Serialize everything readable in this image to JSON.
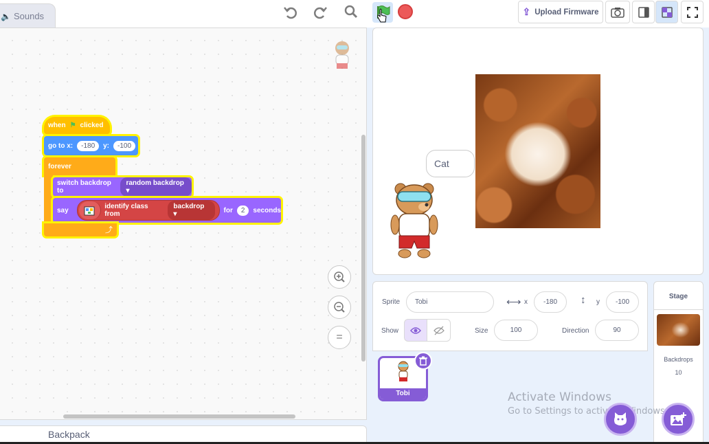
{
  "tabs": {
    "sounds": "Sounds"
  },
  "toolbar": {
    "upload_firmware": "Upload Firmware"
  },
  "script": {
    "hat": {
      "text": "when",
      "text2": "clicked"
    },
    "goto": {
      "label": "go to x:",
      "x": "-180",
      "ylabel": "y:",
      "y": "-100"
    },
    "forever": {
      "label": "forever"
    },
    "switch_backdrop": {
      "label": "switch backdrop to",
      "value": "random backdrop"
    },
    "say": {
      "label": "say",
      "classify": "identify class from",
      "classify_value": "backdrop",
      "for": "for",
      "seconds_value": "2",
      "seconds": "seconds"
    }
  },
  "zoom": {
    "reset": "="
  },
  "backpack": {
    "label": "Backpack"
  },
  "stage": {
    "speech": "Cat"
  },
  "sprite_info": {
    "sprite_label": "Sprite",
    "sprite_name": "Tobi",
    "x_label": "x",
    "x_value": "-180",
    "y_label": "y",
    "y_value": "-100",
    "show_label": "Show",
    "size_label": "Size",
    "size_value": "100",
    "direction_label": "Direction",
    "direction_value": "90"
  },
  "sprites": [
    {
      "name": "Tobi"
    }
  ],
  "stage_panel": {
    "title": "Stage",
    "backdrops_label": "Backdrops",
    "backdrops_count": "10"
  },
  "watermark": {
    "title": "Activate Windows",
    "subtitle": "Go to Settings to activate Windows."
  },
  "colors": {
    "motion": "#4c97ff",
    "looks": "#9966ff",
    "control": "#ffab19",
    "events": "#ffbf00",
    "ml": "#d44545",
    "accent": "#855cd6"
  }
}
